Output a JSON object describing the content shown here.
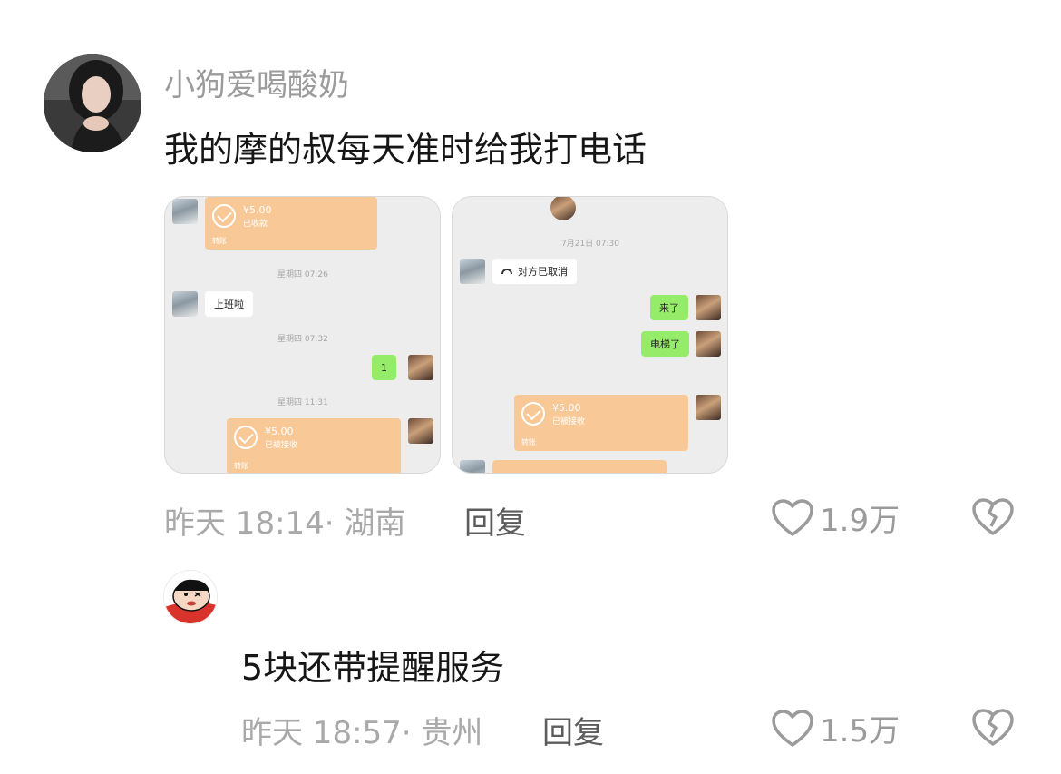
{
  "comments": [
    {
      "username": "小狗爱喝酸奶",
      "text": "我的摩的叔每天准时给我打电话",
      "meta": "昨天 18:14· 湖南",
      "reply_label": "回复",
      "likes": "1.9万",
      "screenshots": [
        {
          "transfer_top": {
            "amount": "¥5.00",
            "status": "已收款",
            "footer": "转账"
          },
          "time_1": "星期四 07:26",
          "msg_friend": "上班啦",
          "time_2": "星期四 07:32",
          "msg_me": "1",
          "time_3": "星期四 11:31",
          "transfer_bottom": {
            "amount": "¥5.00",
            "status": "已被接收",
            "footer": "转账"
          }
        },
        {
          "time_1": "7月21日 07:30",
          "call_status": "对方已取消",
          "msg_me_1": "来了",
          "msg_me_2": "电梯了",
          "transfer": {
            "amount": "¥5.00",
            "status": "已被接收",
            "footer": "转账"
          }
        }
      ]
    },
    {
      "username": "",
      "text": "5块还带提醒服务",
      "meta": "昨天 18:57· 贵州",
      "reply_label": "回复",
      "likes": "1.5万"
    }
  ],
  "icons": {
    "like": "heart-outline-icon",
    "dislike": "broken-heart-icon"
  },
  "colors": {
    "meta_text": "#a9a9a9",
    "username": "#9b9b9b",
    "transfer_orange": "#f8c897",
    "chat_green": "#95ec69"
  }
}
